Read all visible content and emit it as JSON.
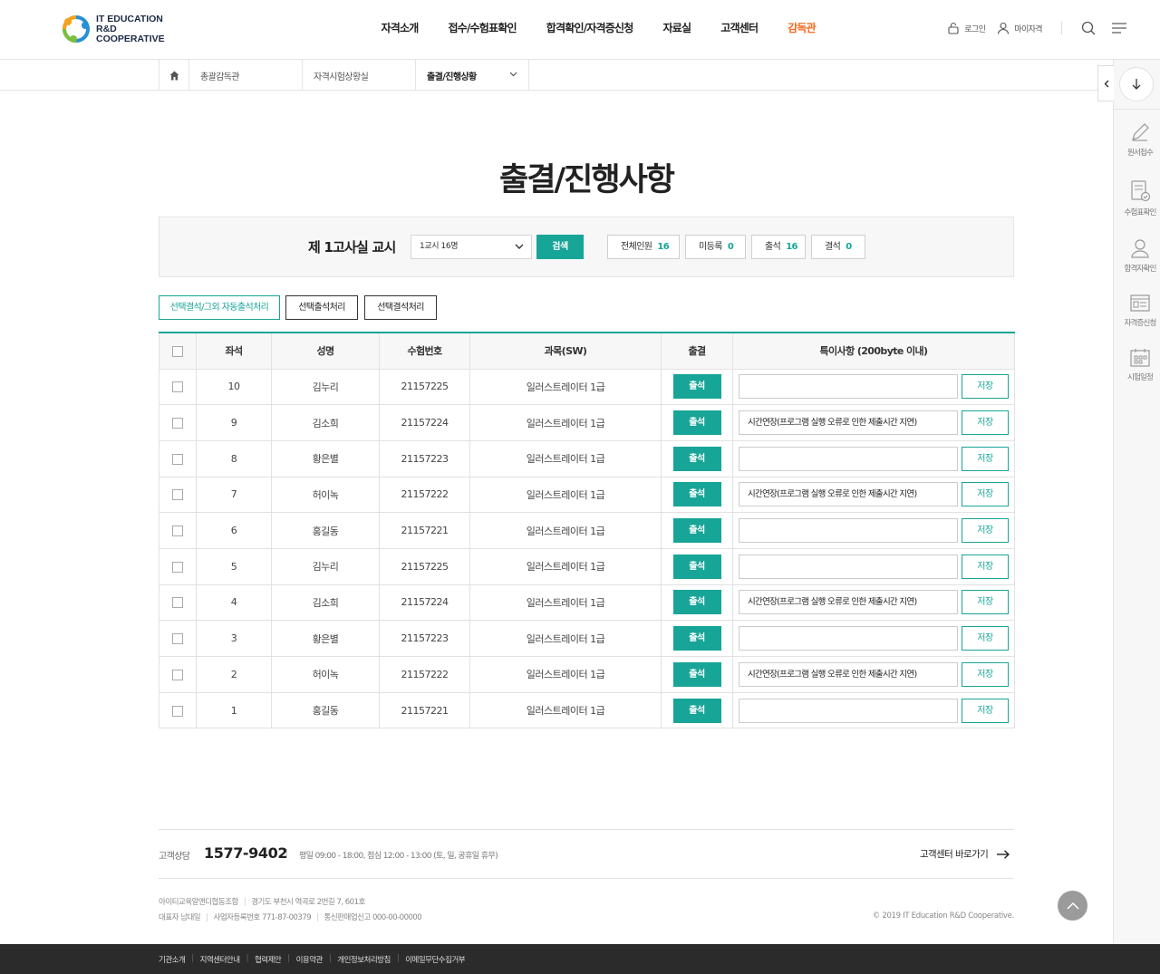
{
  "brand": {
    "line1": "IT EDUCATION",
    "line2": "R&D COOPERATIVE"
  },
  "nav": [
    {
      "label": "자격소개"
    },
    {
      "label": "접수/수험표확인"
    },
    {
      "label": "합격확인/자격증신청"
    },
    {
      "label": "자료실"
    },
    {
      "label": "고객센터"
    },
    {
      "label": "감독관",
      "active": true
    }
  ],
  "util": {
    "login": "로그인",
    "mypage": "마이자격"
  },
  "breadcrumb": {
    "items": [
      "총괄감독관",
      "자격시험상황실",
      "출결/진행상황"
    ]
  },
  "quick": {
    "items": [
      "원서접수",
      "수험표확인",
      "합격자확인",
      "자격증신청",
      "시험일정"
    ]
  },
  "page_title": "출결/진행사항",
  "search": {
    "room_label": "제 1고사실 교시",
    "select_value": "1교시 16명",
    "search_button": "검색",
    "stats": [
      {
        "label": "전체인원",
        "value": "16"
      },
      {
        "label": "미등록",
        "value": "0"
      },
      {
        "label": "출석",
        "value": "16"
      },
      {
        "label": "결석",
        "value": "0"
      }
    ]
  },
  "actions": {
    "auto": "선택결석/그외 자동출석처리",
    "present": "선택출석처리",
    "absent": "선택결석처리"
  },
  "table": {
    "headers": [
      "좌석",
      "성명",
      "수험번호",
      "과목(SW)",
      "출결",
      "특이사항 (200byte 이내)"
    ],
    "attend_label": "출석",
    "save_label": "저장",
    "rows": [
      {
        "seat": "10",
        "name": "김누리",
        "exam_no": "21157225",
        "subject": "일러스트레이터 1급",
        "note": ""
      },
      {
        "seat": "9",
        "name": "김소희",
        "exam_no": "21157224",
        "subject": "일러스트레이터 1급",
        "note": "시간연장(프로그램 실행 오류로 인한 제출시간 지연)"
      },
      {
        "seat": "8",
        "name": "황은별",
        "exam_no": "21157223",
        "subject": "일러스트레이터 1급",
        "note": ""
      },
      {
        "seat": "7",
        "name": "허이녹",
        "exam_no": "21157222",
        "subject": "일러스트레이터 1급",
        "note": "시간연장(프로그램 실행 오류로 인한 제출시간 지연)"
      },
      {
        "seat": "6",
        "name": "홍길동",
        "exam_no": "21157221",
        "subject": "일러스트레이터 1급",
        "note": ""
      },
      {
        "seat": "5",
        "name": "김누리",
        "exam_no": "21157225",
        "subject": "일러스트레이터 1급",
        "note": ""
      },
      {
        "seat": "4",
        "name": "김소희",
        "exam_no": "21157224",
        "subject": "일러스트레이터 1급",
        "note": "시간연장(프로그램 실행 오류로 인한 제출시간 지연)"
      },
      {
        "seat": "3",
        "name": "황은별",
        "exam_no": "21157223",
        "subject": "일러스트레이터 1급",
        "note": ""
      },
      {
        "seat": "2",
        "name": "허이녹",
        "exam_no": "21157222",
        "subject": "일러스트레이터 1급",
        "note": "시간연장(프로그램 실행 오류로 인한 제출시간 지연)"
      },
      {
        "seat": "1",
        "name": "홍길동",
        "exam_no": "21157221",
        "subject": "일러스트레이터 1급",
        "note": ""
      }
    ]
  },
  "footer": {
    "cs_label": "고객상담",
    "cs_tel": "1577-9402",
    "cs_hours": "평일 09:00 - 18:00, 점심 12:00 - 13:00 (토, 일, 공휴일 휴무)",
    "cs_link": "고객센터 바로가기",
    "org": "아이티교육알앤디협동조합",
    "address": "경기도 부천시 역곡로 2번길 7, 601호",
    "ceo": "대표자 남대일",
    "bizno": "사업자등록번호 771-87-00379",
    "mailorder": "통신판매업신고 000-00-00000",
    "copyright": "© 2019 IT Education R&D Cooperative.",
    "links": [
      "기관소개",
      "지역센터안내",
      "협력제안",
      "이용약관",
      "개인정보처리방침",
      "이메일무단수집거부"
    ]
  },
  "colors": {
    "accent": "#17a597",
    "active_nav": "#f06a1d",
    "bottom_bar": "#2b2b2b"
  }
}
